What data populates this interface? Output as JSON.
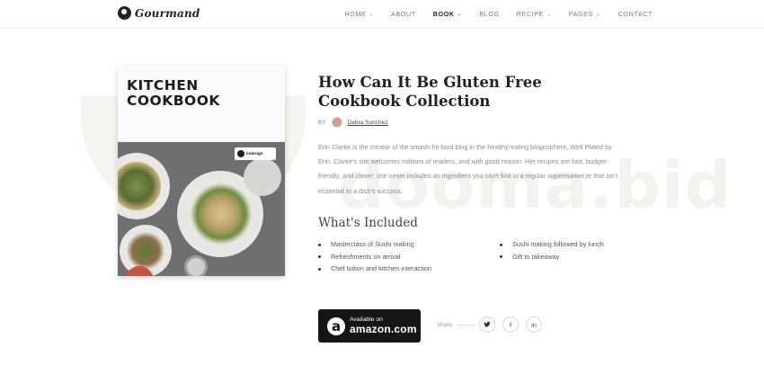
{
  "brand": {
    "name": "Gourmand",
    "icon": "chef-hat-icon"
  },
  "nav": {
    "items": [
      {
        "label": "HOME",
        "caret": true
      },
      {
        "label": "ABOUT",
        "caret": false
      },
      {
        "label": "BOOK",
        "caret": true,
        "active": true
      },
      {
        "label": "BLOG",
        "caret": false
      },
      {
        "label": "RECIPE",
        "caret": true
      },
      {
        "label": "PAGES",
        "caret": true
      },
      {
        "label": "CONTACT",
        "caret": false
      }
    ]
  },
  "watermark": {
    "text": "dooma.bid"
  },
  "cover": {
    "title_line1": "KITCHEN",
    "title_line2": "COOKBOOK",
    "badge": "indesign"
  },
  "book": {
    "title": "How Can It Be Gluten Free Cookbook Collection",
    "by_label": "BY",
    "author": "Debra Sunchez",
    "description": "Erin Clarke is the creator of the smash-hit food blog in the healthy-eating blogosphere, Well Plated by Erin. Clarke's site welcomes millions of readers, and with good reason: Her recipes are fast, budget-friendly, and clever; she never includes an ingredient you can't find in a regular supermarket or that isn't essential to a dish's success.",
    "included_heading": "What's Included",
    "included_left": [
      "Masterclass of Sushi making",
      "Refreshments on arrival",
      "Chef tuition and kitchen interaction"
    ],
    "included_right": [
      "Sushi making followed by lunch",
      "Gift to takeaway"
    ]
  },
  "amazon": {
    "small": "Available on",
    "big": "amazon.com",
    "icon": "amazon-logo-icon"
  },
  "share": {
    "label": "Share",
    "icons": [
      {
        "name": "twitter-icon",
        "glyph": "🐦"
      },
      {
        "name": "facebook-icon",
        "glyph": "f"
      },
      {
        "name": "linkedin-icon",
        "glyph": "in"
      }
    ]
  }
}
